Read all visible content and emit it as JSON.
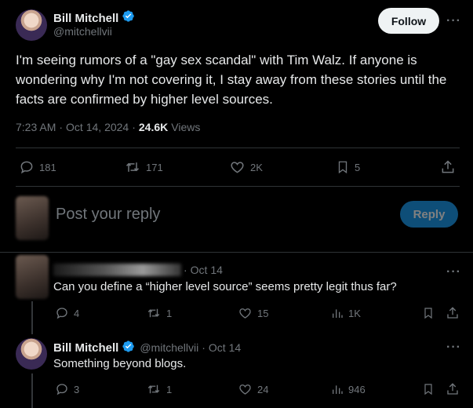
{
  "main_post": {
    "author_name": "Bill Mitchell",
    "author_handle": "@mitchellvii",
    "follow_label": "Follow",
    "text": "I'm seeing rumors of a \"gay sex scandal\" with Tim Walz.  If anyone is wondering why I'm not covering it, I stay away from these stories until the facts are confirmed by higher level sources.",
    "time": "7:23 AM",
    "date": "Oct 14, 2024",
    "views_count": "24.6K",
    "views_label": "Views",
    "replies": "181",
    "reposts": "171",
    "likes": "2K",
    "bookmarks": "5"
  },
  "composer": {
    "placeholder": "Post your reply",
    "reply_label": "Reply"
  },
  "replies": [
    {
      "author_name": "",
      "date": "Oct 14",
      "text": "Can you define a “higher level source” seems pretty legit thus far?",
      "replies": "4",
      "reposts": "1",
      "likes": "15",
      "views": "1K"
    },
    {
      "author_name": "Bill Mitchell",
      "author_handle": "@mitchellvii",
      "date": "Oct 14",
      "text": "Something beyond blogs.",
      "replies": "3",
      "reposts": "1",
      "likes": "24",
      "views": "946"
    }
  ],
  "separator": "·",
  "more_glyph": "···",
  "colors": {
    "accent": "#1d9bf0",
    "muted": "#71767b",
    "divider": "#2f3336"
  }
}
